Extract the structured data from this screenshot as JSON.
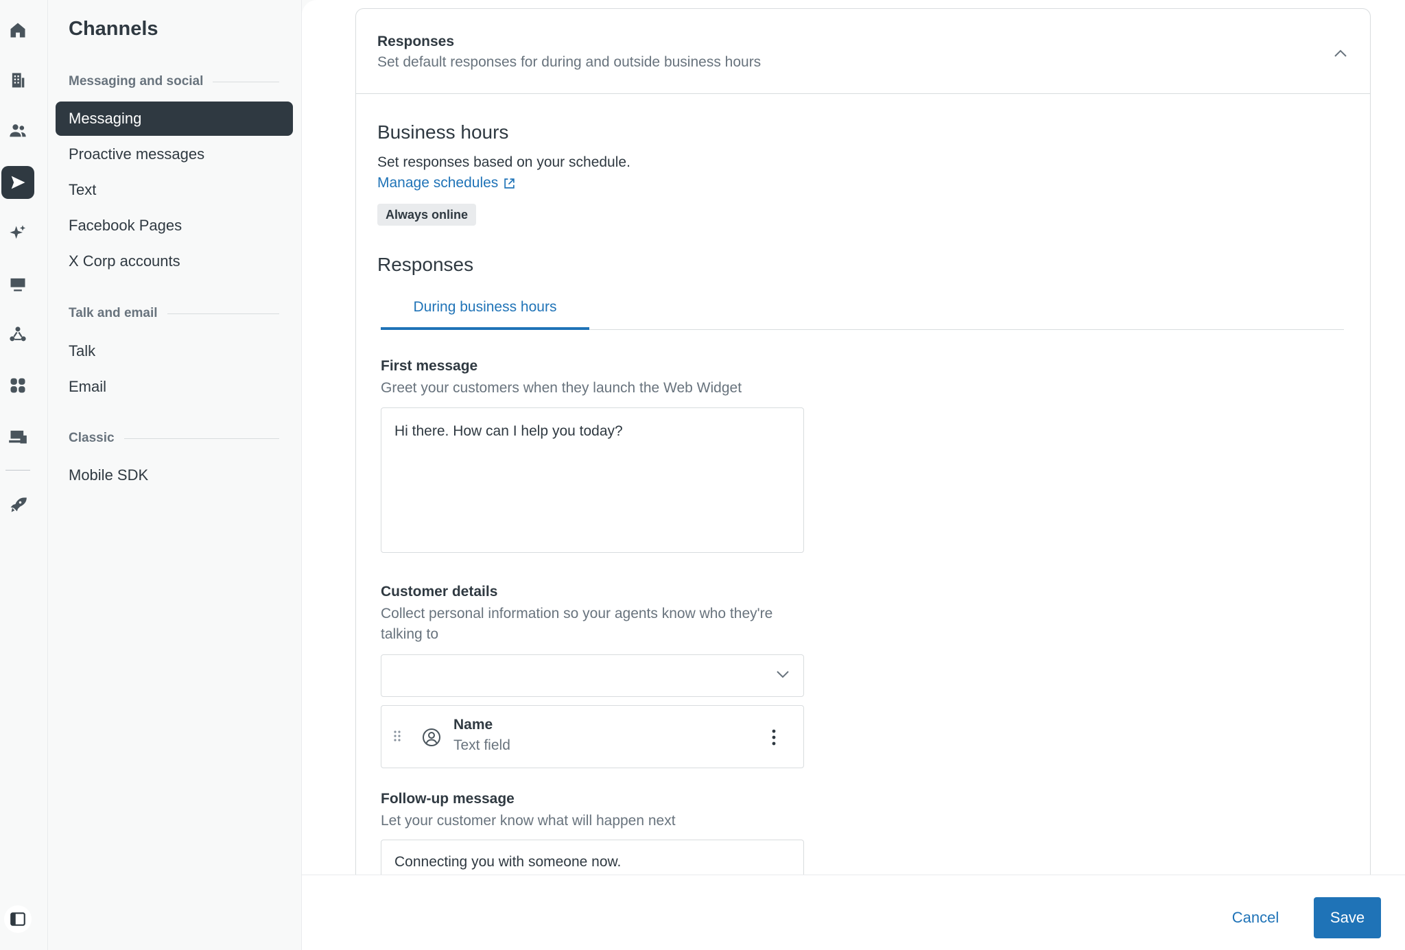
{
  "rail": {
    "icons": [
      "home-icon",
      "building-icon",
      "people-icon",
      "channels-send-icon",
      "sparkle-icon",
      "workspace-icon",
      "objects-icon",
      "apps-icon",
      "account-icon",
      "rocket-icon",
      "collapse-panel-icon"
    ],
    "active": "channels-send-icon"
  },
  "nav": {
    "title": "Channels",
    "sections": [
      {
        "heading": "Messaging and social",
        "items": [
          "Messaging",
          "Proactive messages",
          "Text",
          "Facebook Pages",
          "X Corp accounts"
        ]
      },
      {
        "heading": "Talk and email",
        "items": [
          "Talk",
          "Email"
        ]
      },
      {
        "heading": "Classic",
        "items": [
          "Mobile SDK"
        ]
      }
    ],
    "active_item": "Messaging"
  },
  "card": {
    "title": "Responses",
    "subtitle": "Set default responses for during and outside business hours"
  },
  "business_hours": {
    "heading": "Business hours",
    "description": "Set responses based on your schedule.",
    "link_label": "Manage schedules",
    "badge": "Always online"
  },
  "responses": {
    "heading": "Responses",
    "tabs": [
      "During business hours"
    ],
    "first_message": {
      "label": "First message",
      "hint": "Greet your customers when they launch the Web Widget",
      "value": "Hi there. How can I help you today?"
    },
    "customer_details": {
      "label": "Customer details",
      "hint": "Collect personal information so your agents know who they're talking to",
      "select_value": "",
      "fields": [
        {
          "name": "Name",
          "type": "Text field"
        }
      ]
    },
    "follow_up": {
      "label": "Follow-up message",
      "hint": "Let your customer know what will happen next",
      "value": "Connecting you with someone now."
    }
  },
  "footer": {
    "cancel_label": "Cancel",
    "save_label": "Save"
  },
  "colors": {
    "accent": "#1f73b7",
    "active_nav": "#2f3941",
    "text": "#2f3941",
    "muted": "#68737d"
  }
}
